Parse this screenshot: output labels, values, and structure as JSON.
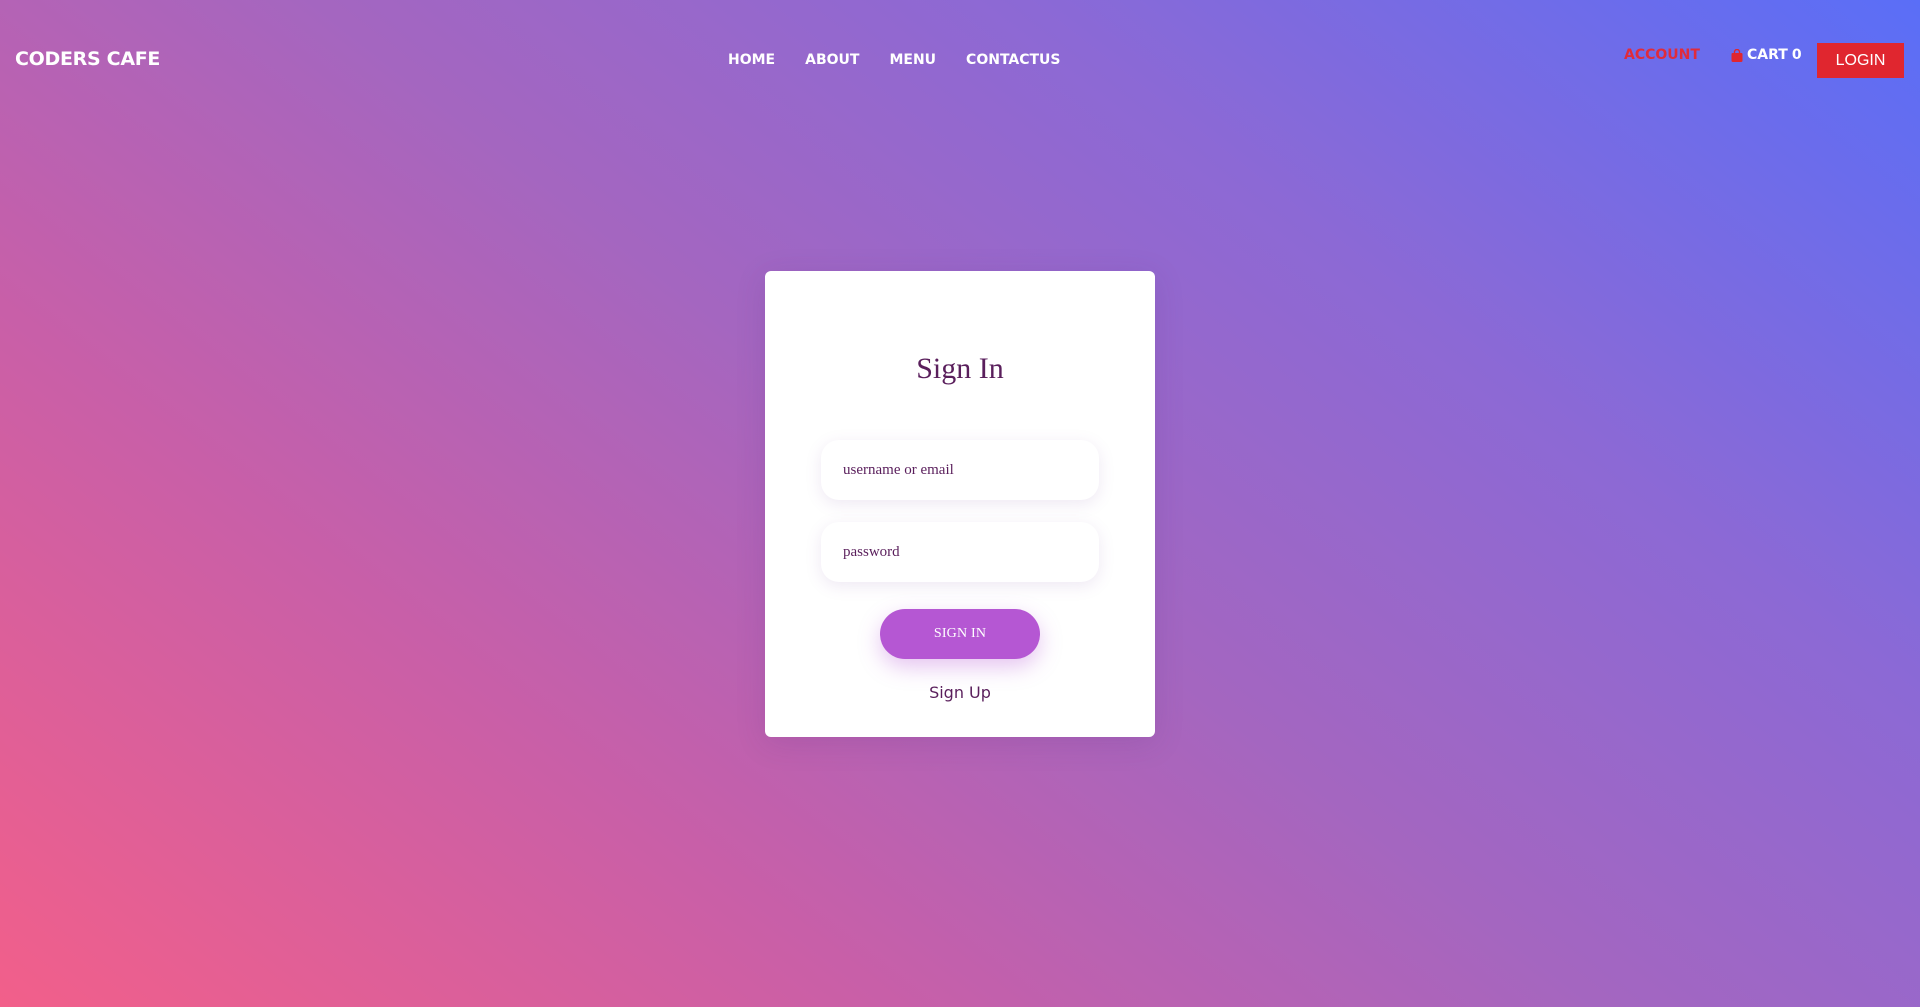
{
  "brand": {
    "logo_text": "CODERS CAFE"
  },
  "nav": {
    "items": [
      {
        "label": "HOME"
      },
      {
        "label": "ABOUT"
      },
      {
        "label": "MENU"
      },
      {
        "label": "CONTACTUS"
      }
    ]
  },
  "header_actions": {
    "account_label": "ACCOUNT",
    "cart_label": "CART",
    "cart_count": "0",
    "cart_icon": "shopping-bag-icon",
    "login_label": "LOGIN"
  },
  "signin_form": {
    "title": "Sign In",
    "username_placeholder": "username or email",
    "username_value": "",
    "password_placeholder": "password",
    "password_value": "",
    "submit_label": "SIGN IN",
    "signup_label": "Sign Up"
  },
  "colors": {
    "gradient_start": "#f25f8a",
    "gradient_end": "#5a6ef7",
    "accent_red": "#e0262f",
    "button_purple": "#b557d3",
    "text_plum": "#5a1f5c"
  }
}
